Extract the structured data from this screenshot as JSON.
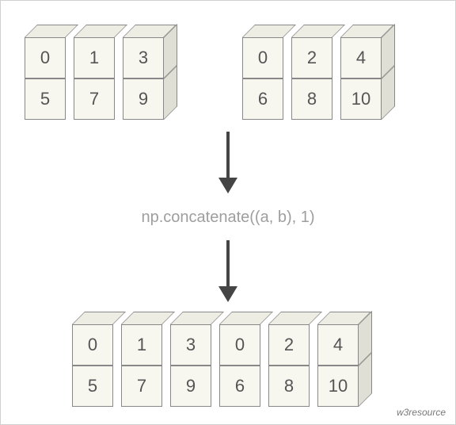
{
  "chart_data": {
    "type": "table",
    "arrays": {
      "a": [
        [
          0,
          1,
          3
        ],
        [
          5,
          7,
          9
        ]
      ],
      "b": [
        [
          0,
          2,
          4
        ],
        [
          6,
          8,
          10
        ]
      ],
      "result": [
        [
          0,
          1,
          3,
          0,
          2,
          4
        ],
        [
          5,
          7,
          9,
          6,
          8,
          10
        ]
      ]
    },
    "operation": "np.concatenate((a, b), 1)"
  },
  "code_label": "np.concatenate((a, b), 1)",
  "array_a": {
    "r0": {
      "c0": "0",
      "c1": "1",
      "c2": "3"
    },
    "r1": {
      "c0": "5",
      "c1": "7",
      "c2": "9"
    }
  },
  "array_b": {
    "r0": {
      "c0": "0",
      "c1": "2",
      "c2": "4"
    },
    "r1": {
      "c0": "6",
      "c1": "8",
      "c2": "10"
    }
  },
  "result": {
    "r0": {
      "c0": "0",
      "c1": "1",
      "c2": "3",
      "c3": "0",
      "c4": "2",
      "c5": "4"
    },
    "r1": {
      "c0": "5",
      "c1": "7",
      "c2": "9",
      "c3": "6",
      "c4": "8",
      "c5": "10"
    }
  },
  "footer": "w3resource"
}
